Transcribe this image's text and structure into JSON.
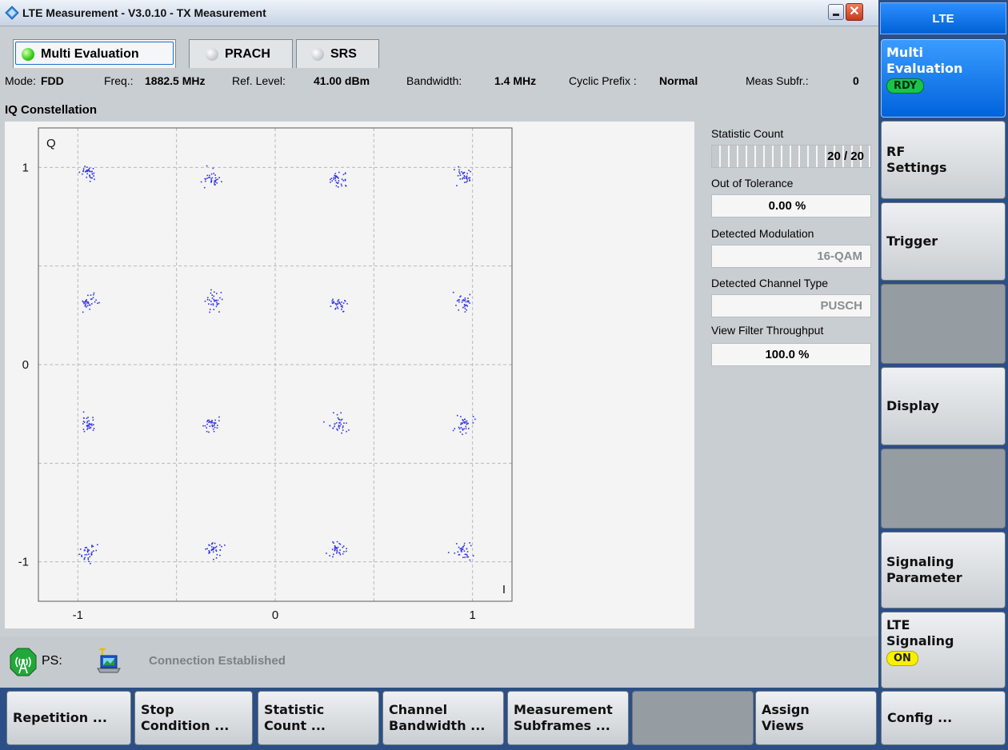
{
  "window": {
    "title": "LTE Measurement  - V3.0.10 - TX Measurement",
    "close_glyph": "✕"
  },
  "tabs": [
    {
      "label": "Multi Evaluation",
      "active": true
    },
    {
      "label": "PRACH",
      "active": false
    },
    {
      "label": "SRS",
      "active": false
    }
  ],
  "info": {
    "mode_label": "Mode:",
    "mode_value": "FDD",
    "freq_label": "Freq.:",
    "freq_value": "1882.5 MHz",
    "ref_label": "Ref. Level:",
    "ref_value": "41.00 dBm",
    "bw_label": "Bandwidth:",
    "bw_value": "1.4 MHz",
    "cp_label": "Cyclic Prefix :",
    "cp_value": "Normal",
    "subfr_label": "Meas Subfr.:",
    "subfr_value": "0"
  },
  "section_title": "IQ Constellation",
  "chart_data": {
    "type": "scatter",
    "title": "IQ Constellation",
    "xlabel": "I",
    "ylabel": "Q",
    "xlim": [
      -1.2,
      1.2
    ],
    "ylim": [
      -1.2,
      1.2
    ],
    "xticks": [
      -1,
      0,
      1
    ],
    "yticks": [
      1,
      0,
      -1
    ],
    "grid": true,
    "gridlines": [
      -1,
      -0.5,
      0,
      0.5,
      1
    ],
    "color": "#3030e8",
    "series": [
      {
        "x": [
          -0.95,
          -0.32,
          0.32,
          0.95,
          -0.95,
          -0.32,
          0.32,
          0.95,
          -0.95,
          -0.32,
          0.32,
          0.95,
          -0.95,
          -0.32,
          0.32,
          0.95
        ],
        "y": [
          0.97,
          0.95,
          0.94,
          0.96,
          0.32,
          0.32,
          0.31,
          0.32,
          -0.3,
          -0.3,
          -0.3,
          -0.3,
          -0.95,
          -0.93,
          -0.93,
          -0.94
        ]
      }
    ]
  },
  "side": {
    "stat_label": "Statistic Count",
    "stat_value": "20 / 20",
    "stat_fraction": 1.0,
    "oot_label": "Out of Tolerance",
    "oot_value": "0.00 %",
    "mod_label": "Detected Modulation",
    "mod_value": "16-QAM",
    "chan_label": "Detected Channel Type",
    "chan_value": "PUSCH",
    "vft_label": "View Filter Throughput",
    "vft_value": "100.0 %"
  },
  "status": {
    "ps_label": "PS:",
    "connection": "Connection Established"
  },
  "right_panel": {
    "header": "LTE",
    "keys": [
      {
        "label_1": "Multi",
        "label_2": "Evaluation",
        "badge": "RDY"
      },
      {
        "label_1": "RF",
        "label_2": "Settings"
      },
      {
        "label_1": "Trigger"
      },
      {
        "label_1": "Display"
      },
      {
        "label_1": "Signaling",
        "label_2": "Parameter"
      },
      {
        "label_1": "LTE",
        "label_2": "Signaling",
        "badge": "ON"
      }
    ]
  },
  "bottom_keys": [
    {
      "label_1": "Repetition ..."
    },
    {
      "label_1": "Stop",
      "label_2": "Condition ..."
    },
    {
      "label_1": "Statistic",
      "label_2": "Count ..."
    },
    {
      "label_1": "Channel",
      "label_2": "Bandwidth ..."
    },
    {
      "label_1": "Measurement",
      "label_2": "Subframes ..."
    },
    {
      "label_1": "Assign",
      "label_2": "Views"
    },
    {
      "label_1": "Config ..."
    }
  ]
}
